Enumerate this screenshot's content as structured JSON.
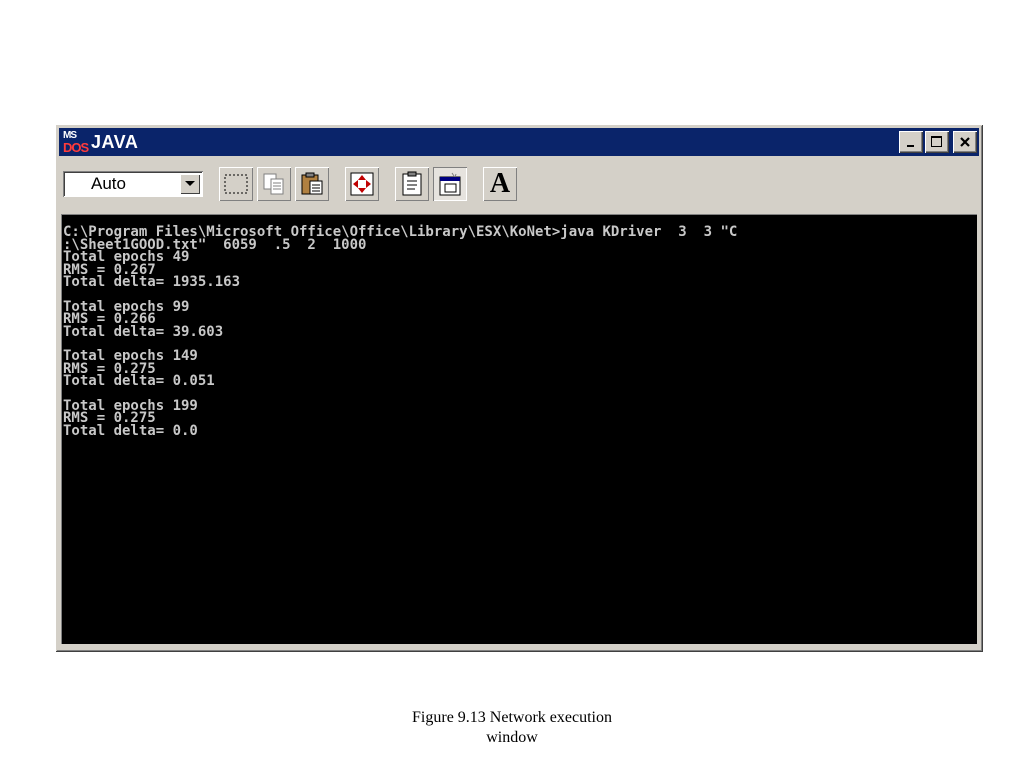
{
  "window": {
    "title": "JAVA",
    "icon_lines": [
      "MS",
      "DOS"
    ],
    "controls": [
      "minimize-icon",
      "maximize-icon",
      "close-icon"
    ]
  },
  "toolbar": {
    "font_size_select": "Auto",
    "buttons": [
      "mark-icon",
      "copy-icon",
      "paste-icon",
      "fullscreen-icon",
      "properties-icon",
      "background-icon",
      "font-icon"
    ],
    "font_button_label": "A"
  },
  "console": {
    "lines": [
      "C:\\Program Files\\Microsoft Office\\Office\\Library\\ESX\\KoNet>java KDriver  3  3 \"C",
      ":\\Sheet1GOOD.txt\"  6059  .5  2  1000",
      "Total epochs 49",
      "RMS = 0.267",
      "Total delta= 1935.163",
      "",
      "Total epochs 99",
      "RMS = 0.266",
      "Total delta= 39.603",
      "",
      "Total epochs 149",
      "RMS = 0.275",
      "Total delta= 0.051",
      "",
      "Total epochs 199",
      "RMS = 0.275",
      "Total delta= 0.0"
    ]
  },
  "caption": {
    "line1": "Figure 9.13 Network execution",
    "line2": "window"
  }
}
